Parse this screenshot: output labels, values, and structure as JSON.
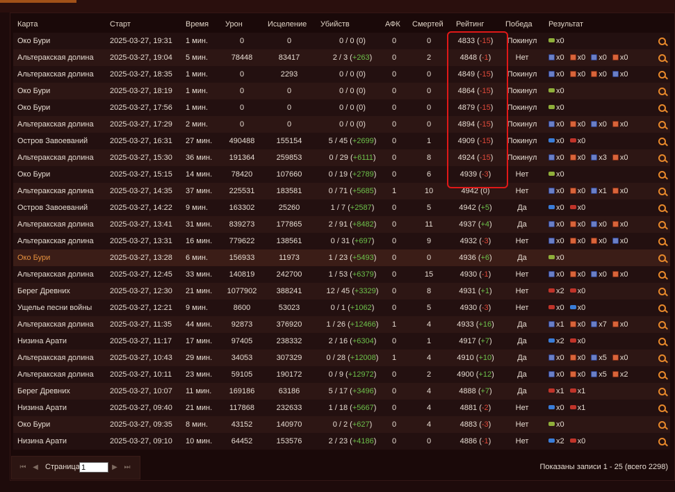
{
  "header": {
    "map": "Карта",
    "start": "Старт",
    "time": "Время",
    "damage": "Урон",
    "healing": "Исцеление",
    "kills": "Убийств",
    "afk": "АФК",
    "deaths": "Смертей",
    "rating": "Рейтинг",
    "win": "Победа",
    "result": "Результат"
  },
  "rows": [
    {
      "map": "Око Бури",
      "start": "2025-03-27, 19:31",
      "time": "1 мин.",
      "damage": "0",
      "healing": "0",
      "kills": "0 / 0 (0)",
      "kills_delta": "",
      "afk": "0",
      "deaths": "0",
      "rating": "4833",
      "rating_delta": "-15",
      "win": "Покинул",
      "result": [
        {
          "icon": "flag-g",
          "text": "x0"
        }
      ]
    },
    {
      "map": "Альтеракская долина",
      "start": "2025-03-27, 19:04",
      "time": "5 мин.",
      "damage": "78448",
      "healing": "83417",
      "kills": "2 / 3",
      "kills_delta": "+263",
      "afk": "0",
      "deaths": "2",
      "rating": "4848",
      "rating_delta": "-1",
      "win": "Нет",
      "result": [
        {
          "icon": "ally",
          "text": "x0"
        },
        {
          "icon": "horde",
          "text": "x0"
        },
        {
          "icon": "ally",
          "text": "x0"
        },
        {
          "icon": "horde",
          "text": "x0"
        }
      ]
    },
    {
      "map": "Альтеракская долина",
      "start": "2025-03-27, 18:35",
      "time": "1 мин.",
      "damage": "0",
      "healing": "2293",
      "kills": "0 / 0 (0)",
      "kills_delta": "",
      "afk": "0",
      "deaths": "0",
      "rating": "4849",
      "rating_delta": "-15",
      "win": "Покинул",
      "result": [
        {
          "icon": "ally",
          "text": "x0"
        },
        {
          "icon": "horde",
          "text": "x0"
        },
        {
          "icon": "horde",
          "text": "x0"
        },
        {
          "icon": "ally",
          "text": "x0"
        }
      ]
    },
    {
      "map": "Око Бури",
      "start": "2025-03-27, 18:19",
      "time": "1 мин.",
      "damage": "0",
      "healing": "0",
      "kills": "0 / 0 (0)",
      "kills_delta": "",
      "afk": "0",
      "deaths": "0",
      "rating": "4864",
      "rating_delta": "-15",
      "win": "Покинул",
      "result": [
        {
          "icon": "flag-g",
          "text": "x0"
        }
      ]
    },
    {
      "map": "Око Бури",
      "start": "2025-03-27, 17:56",
      "time": "1 мин.",
      "damage": "0",
      "healing": "0",
      "kills": "0 / 0 (0)",
      "kills_delta": "",
      "afk": "0",
      "deaths": "0",
      "rating": "4879",
      "rating_delta": "-15",
      "win": "Покинул",
      "result": [
        {
          "icon": "flag-g",
          "text": "x0"
        }
      ]
    },
    {
      "map": "Альтеракская долина",
      "start": "2025-03-27, 17:29",
      "time": "2 мин.",
      "damage": "0",
      "healing": "0",
      "kills": "0 / 0 (0)",
      "kills_delta": "",
      "afk": "0",
      "deaths": "0",
      "rating": "4894",
      "rating_delta": "-15",
      "win": "Покинул",
      "result": [
        {
          "icon": "ally",
          "text": "x0"
        },
        {
          "icon": "horde",
          "text": "x0"
        },
        {
          "icon": "ally",
          "text": "x0"
        },
        {
          "icon": "horde",
          "text": "x0"
        }
      ]
    },
    {
      "map": "Остров Завоеваний",
      "start": "2025-03-27, 16:31",
      "time": "27 мин.",
      "damage": "490488",
      "healing": "155154",
      "kills": "5 / 45",
      "kills_delta": "+2699",
      "afk": "0",
      "deaths": "1",
      "rating": "4909",
      "rating_delta": "-15",
      "win": "Покинул",
      "result": [
        {
          "icon": "flag-b",
          "text": "x0"
        },
        {
          "icon": "flag-r",
          "text": "x0"
        }
      ]
    },
    {
      "map": "Альтеракская долина",
      "start": "2025-03-27, 15:30",
      "time": "36 мин.",
      "damage": "191364",
      "healing": "259853",
      "kills": "0 / 29",
      "kills_delta": "+6111",
      "afk": "0",
      "deaths": "8",
      "rating": "4924",
      "rating_delta": "-15",
      "win": "Покинул",
      "result": [
        {
          "icon": "ally",
          "text": "x0"
        },
        {
          "icon": "horde",
          "text": "x0"
        },
        {
          "icon": "ally",
          "text": "x3"
        },
        {
          "icon": "horde",
          "text": "x0"
        }
      ]
    },
    {
      "map": "Око Бури",
      "start": "2025-03-27, 15:15",
      "time": "14 мин.",
      "damage": "78420",
      "healing": "107660",
      "kills": "0 / 19",
      "kills_delta": "+2789",
      "afk": "0",
      "deaths": "6",
      "rating": "4939",
      "rating_delta": "-3",
      "win": "Нет",
      "result": [
        {
          "icon": "flag-g",
          "text": "x0"
        }
      ]
    },
    {
      "map": "Альтеракская долина",
      "start": "2025-03-27, 14:35",
      "time": "37 мин.",
      "damage": "225531",
      "healing": "183581",
      "kills": "0 / 71",
      "kills_delta": "+5685",
      "afk": "1",
      "deaths": "10",
      "rating": "4942",
      "rating_delta": "0",
      "win": "Нет",
      "result": [
        {
          "icon": "ally",
          "text": "x0"
        },
        {
          "icon": "horde",
          "text": "x0"
        },
        {
          "icon": "ally",
          "text": "x1"
        },
        {
          "icon": "horde",
          "text": "x0"
        }
      ]
    },
    {
      "map": "Остров Завоеваний",
      "start": "2025-03-27, 14:22",
      "time": "9 мин.",
      "damage": "163302",
      "healing": "25260",
      "kills": "1 / 7",
      "kills_delta": "+2587",
      "afk": "0",
      "deaths": "5",
      "rating": "4942",
      "rating_delta": "+5",
      "win": "Да",
      "result": [
        {
          "icon": "flag-b",
          "text": "x0"
        },
        {
          "icon": "flag-r",
          "text": "x0"
        }
      ]
    },
    {
      "map": "Альтеракская долина",
      "start": "2025-03-27, 13:41",
      "time": "31 мин.",
      "damage": "839273",
      "healing": "177865",
      "kills": "2 / 91",
      "kills_delta": "+8482",
      "afk": "0",
      "deaths": "11",
      "rating": "4937",
      "rating_delta": "+4",
      "win": "Да",
      "result": [
        {
          "icon": "ally",
          "text": "x0"
        },
        {
          "icon": "horde",
          "text": "x0"
        },
        {
          "icon": "ally",
          "text": "x0"
        },
        {
          "icon": "horde",
          "text": "x0"
        }
      ]
    },
    {
      "map": "Альтеракская долина",
      "start": "2025-03-27, 13:31",
      "time": "16 мин.",
      "damage": "779622",
      "healing": "138561",
      "kills": "0 / 31",
      "kills_delta": "+697",
      "afk": "0",
      "deaths": "9",
      "rating": "4932",
      "rating_delta": "-3",
      "win": "Нет",
      "result": [
        {
          "icon": "ally",
          "text": "x0"
        },
        {
          "icon": "horde",
          "text": "x0"
        },
        {
          "icon": "horde",
          "text": "x0"
        },
        {
          "icon": "ally",
          "text": "x0"
        }
      ]
    },
    {
      "map": "Око Бури",
      "start": "2025-03-27, 13:28",
      "time": "6 мин.",
      "damage": "156933",
      "healing": "11973",
      "kills": "1 / 23",
      "kills_delta": "+5493",
      "afk": "0",
      "deaths": "0",
      "rating": "4936",
      "rating_delta": "+6",
      "win": "Да",
      "result": [
        {
          "icon": "flag-g",
          "text": "x0"
        }
      ]
    },
    {
      "map": "Альтеракская долина",
      "start": "2025-03-27, 12:45",
      "time": "33 мин.",
      "damage": "140819",
      "healing": "242700",
      "kills": "1 / 53",
      "kills_delta": "+6379",
      "afk": "0",
      "deaths": "15",
      "rating": "4930",
      "rating_delta": "-1",
      "win": "Нет",
      "result": [
        {
          "icon": "ally",
          "text": "x0"
        },
        {
          "icon": "horde",
          "text": "x0"
        },
        {
          "icon": "ally",
          "text": "x0"
        },
        {
          "icon": "horde",
          "text": "x0"
        }
      ]
    },
    {
      "map": "Берег Древних",
      "start": "2025-03-27, 12:30",
      "time": "21 мин.",
      "damage": "1077902",
      "healing": "388241",
      "kills": "12 / 45",
      "kills_delta": "+3329",
      "afk": "0",
      "deaths": "8",
      "rating": "4931",
      "rating_delta": "+1",
      "win": "Нет",
      "result": [
        {
          "icon": "flag-r",
          "text": "x2"
        },
        {
          "icon": "flag-r",
          "text": "x0"
        }
      ]
    },
    {
      "map": "Ущелье песни войны",
      "start": "2025-03-27, 12:21",
      "time": "9 мин.",
      "damage": "8600",
      "healing": "53023",
      "kills": "0 / 1",
      "kills_delta": "+1062",
      "afk": "0",
      "deaths": "5",
      "rating": "4930",
      "rating_delta": "-3",
      "win": "Нет",
      "result": [
        {
          "icon": "flag-r",
          "text": "x0"
        },
        {
          "icon": "flag-b",
          "text": "x0"
        }
      ]
    },
    {
      "map": "Альтеракская долина",
      "start": "2025-03-27, 11:35",
      "time": "44 мин.",
      "damage": "92873",
      "healing": "376920",
      "kills": "1 / 26",
      "kills_delta": "+12466",
      "afk": "1",
      "deaths": "4",
      "rating": "4933",
      "rating_delta": "+16",
      "win": "Да",
      "result": [
        {
          "icon": "ally",
          "text": "x1"
        },
        {
          "icon": "horde",
          "text": "x0"
        },
        {
          "icon": "ally",
          "text": "x7"
        },
        {
          "icon": "horde",
          "text": "x0"
        }
      ]
    },
    {
      "map": "Низина Арати",
      "start": "2025-03-27, 11:17",
      "time": "17 мин.",
      "damage": "97405",
      "healing": "238332",
      "kills": "2 / 16",
      "kills_delta": "+6304",
      "afk": "0",
      "deaths": "1",
      "rating": "4917",
      "rating_delta": "+7",
      "win": "Да",
      "result": [
        {
          "icon": "flag-b",
          "text": "x2"
        },
        {
          "icon": "flag-r",
          "text": "x0"
        }
      ]
    },
    {
      "map": "Альтеракская долина",
      "start": "2025-03-27, 10:43",
      "time": "29 мин.",
      "damage": "34053",
      "healing": "307329",
      "kills": "0 / 28",
      "kills_delta": "+12008",
      "afk": "1",
      "deaths": "4",
      "rating": "4910",
      "rating_delta": "+10",
      "win": "Да",
      "result": [
        {
          "icon": "ally",
          "text": "x0"
        },
        {
          "icon": "horde",
          "text": "x0"
        },
        {
          "icon": "ally",
          "text": "x5"
        },
        {
          "icon": "horde",
          "text": "x0"
        }
      ]
    },
    {
      "map": "Альтеракская долина",
      "start": "2025-03-27, 10:11",
      "time": "23 мин.",
      "damage": "59105",
      "healing": "190172",
      "kills": "0 / 9",
      "kills_delta": "+12972",
      "afk": "0",
      "deaths": "2",
      "rating": "4900",
      "rating_delta": "+12",
      "win": "Да",
      "result": [
        {
          "icon": "ally",
          "text": "x0"
        },
        {
          "icon": "horde",
          "text": "x0"
        },
        {
          "icon": "ally",
          "text": "x5"
        },
        {
          "icon": "horde",
          "text": "x2"
        }
      ]
    },
    {
      "map": "Берег Древних",
      "start": "2025-03-27, 10:07",
      "time": "11 мин.",
      "damage": "169186",
      "healing": "63186",
      "kills": "5 / 17",
      "kills_delta": "+3496",
      "afk": "0",
      "deaths": "4",
      "rating": "4888",
      "rating_delta": "+7",
      "win": "Да",
      "result": [
        {
          "icon": "flag-r",
          "text": "x1"
        },
        {
          "icon": "flag-r",
          "text": "x1"
        }
      ]
    },
    {
      "map": "Низина Арати",
      "start": "2025-03-27, 09:40",
      "time": "21 мин.",
      "damage": "117868",
      "healing": "232633",
      "kills": "1 / 18",
      "kills_delta": "+5667",
      "afk": "0",
      "deaths": "4",
      "rating": "4881",
      "rating_delta": "-2",
      "win": "Нет",
      "result": [
        {
          "icon": "flag-b",
          "text": "x0"
        },
        {
          "icon": "flag-r",
          "text": "x1"
        }
      ]
    },
    {
      "map": "Око Бури",
      "start": "2025-03-27, 09:35",
      "time": "8 мин.",
      "damage": "43152",
      "healing": "140970",
      "kills": "0 / 2",
      "kills_delta": "+627",
      "afk": "0",
      "deaths": "4",
      "rating": "4883",
      "rating_delta": "-3",
      "win": "Нет",
      "result": [
        {
          "icon": "flag-g",
          "text": "x0"
        }
      ]
    },
    {
      "map": "Низина Арати",
      "start": "2025-03-27, 09:10",
      "time": "10 мин.",
      "damage": "64452",
      "healing": "153576",
      "kills": "2 / 23",
      "kills_delta": "+4186",
      "afk": "0",
      "deaths": "0",
      "rating": "4886",
      "rating_delta": "-1",
      "win": "Нет",
      "result": [
        {
          "icon": "flag-b",
          "text": "x2"
        },
        {
          "icon": "flag-r",
          "text": "x0"
        }
      ]
    }
  ],
  "selected_row": 13,
  "pager": {
    "page_label": "Страница",
    "page_value": "1"
  },
  "summary": "Показаны записи 1 - 25 (всего 2298)",
  "colors": {
    "positive": "#6cc04a",
    "negative": "#e04a3a",
    "highlight": "#e01818",
    "accent": "#e8892b"
  }
}
